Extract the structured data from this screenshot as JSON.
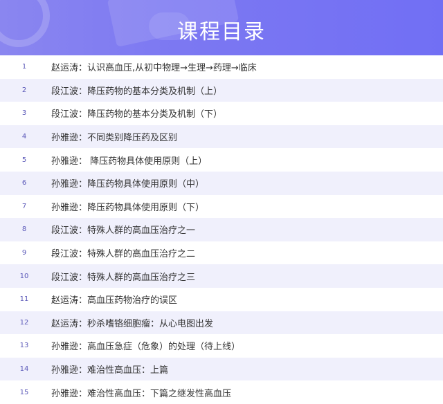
{
  "header": {
    "title": "课程目录"
  },
  "lessons": [
    {
      "num": "1",
      "text": "赵运涛：认识高血压,从初中物理→生理→药理→临床"
    },
    {
      "num": "2",
      "text": "段江波：降压药物的基本分类及机制（上）"
    },
    {
      "num": "3",
      "text": "段江波：降压药物的基本分类及机制（下）"
    },
    {
      "num": "4",
      "text": "孙雅逊：不同类别降压药及区别"
    },
    {
      "num": "5",
      "text": "孙雅逊： 降压药物具体使用原则（上）"
    },
    {
      "num": "6",
      "text": "孙雅逊：降压药物具体使用原则（中）"
    },
    {
      "num": "7",
      "text": "孙雅逊：降压药物具体使用原则（下）"
    },
    {
      "num": "8",
      "text": "段江波：特殊人群的高血压治疗之一"
    },
    {
      "num": "9",
      "text": "段江波：特殊人群的高血压治疗之二"
    },
    {
      "num": "10",
      "text": "段江波：特殊人群的高血压治疗之三"
    },
    {
      "num": "11",
      "text": "赵运涛：高血压药物治疗的误区"
    },
    {
      "num": "12",
      "text": "赵运涛：秒杀嗜铬细胞瘤：从心电图出发"
    },
    {
      "num": "13",
      "text": "孙雅逊：高血压急症（危象）的处理（待上线）"
    },
    {
      "num": "14",
      "text": "孙雅逊：难治性高血压：上篇"
    },
    {
      "num": "15",
      "text": "孙雅逊：难治性高血压：下篇之继发性高血压"
    }
  ]
}
